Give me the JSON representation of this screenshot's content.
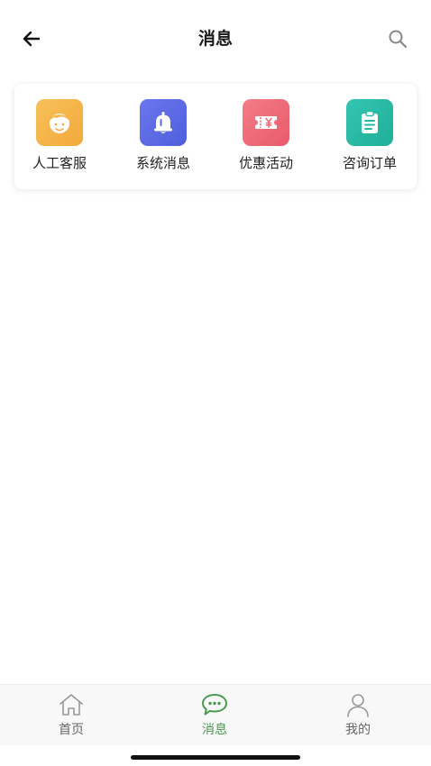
{
  "header": {
    "title": "消息"
  },
  "entries": [
    {
      "label": "人工客服",
      "icon": "customer-service-icon",
      "color": "#f5b94a"
    },
    {
      "label": "系统消息",
      "icon": "bell-icon",
      "color": "#5b6be6"
    },
    {
      "label": "优惠活动",
      "icon": "coupon-icon",
      "color": "#ef6a78"
    },
    {
      "label": "咨询订单",
      "icon": "clipboard-icon",
      "color": "#27b9a4"
    }
  ],
  "tabbar": {
    "active_color": "#4a9a52",
    "items": [
      {
        "label": "首页",
        "icon": "home-icon"
      },
      {
        "label": "消息",
        "icon": "chat-bubble-icon",
        "active": true
      },
      {
        "label": "我的",
        "icon": "profile-icon"
      }
    ]
  }
}
